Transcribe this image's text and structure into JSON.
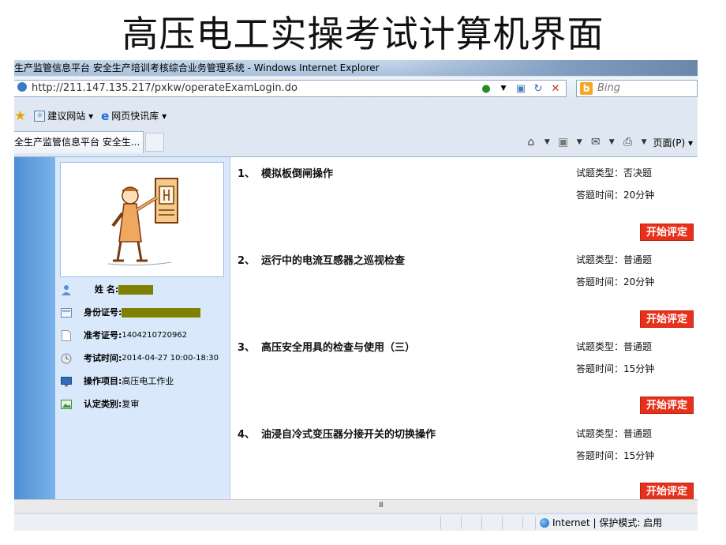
{
  "slide": {
    "title": "高压电工实操考试计算机界面"
  },
  "window": {
    "title": "生产监管信息平台 安全生产培训考核综合业务管理系统 - Windows Internet Explorer"
  },
  "address": {
    "url": "http://211.147.135.217/pxkw/operateExamLogin.do",
    "search_placeholder": "Bing"
  },
  "favorites": {
    "items": [
      "建议网站 ▾",
      "网页快讯库 ▾"
    ]
  },
  "tab": {
    "label": "全生产监管信息平台 安全生..."
  },
  "commandbar": {
    "page_menu": "页面(P) ▾"
  },
  "candidate": {
    "name_label": "姓  名:",
    "id_label": "身份证号:",
    "ticket_label": "准考证号:",
    "ticket_value": "1404210720962",
    "time_label": "考试时间:",
    "time_value": "2014-04-27 10:00-18:30",
    "project_label": "操作项目:",
    "project_value": "高压电工作业",
    "category_label": "认定类别:",
    "category_value": "复审"
  },
  "questions": [
    {
      "num": "1、",
      "title": "模拟板倒闸操作",
      "type": "试题类型：否决题",
      "time": "答题时间：20分钟",
      "button": "开始评定"
    },
    {
      "num": "2、",
      "title": "运行中的电流互感器之巡视检查",
      "type": "试题类型：普通题",
      "time": "答题时间：20分钟",
      "button": "开始评定"
    },
    {
      "num": "3、",
      "title": "高压安全用具的检查与使用（三）",
      "type": "试题类型：普通题",
      "time": "答题时间：15分钟",
      "button": "开始评定"
    },
    {
      "num": "4、",
      "title": "油浸自冷式变压器分接开关的切换操作",
      "type": "试题类型：普通题",
      "time": "答题时间：15分钟",
      "button": "开始评定"
    }
  ],
  "status": {
    "zone": "Internet | 保护模式: 启用"
  }
}
